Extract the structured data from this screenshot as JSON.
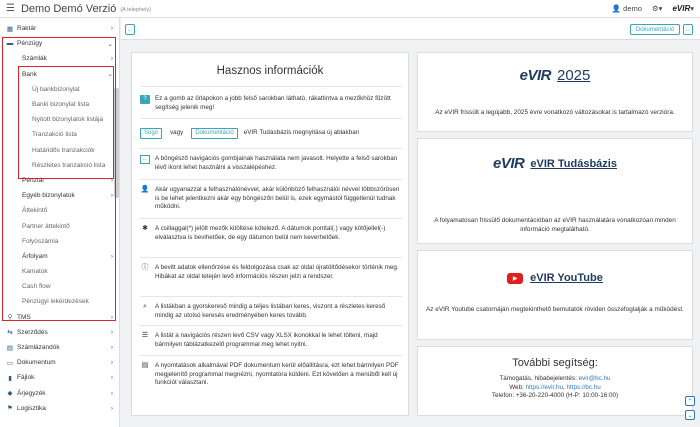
{
  "topbar": {
    "app_title": "Demo Demó Verzió",
    "app_subtitle": "(A telephely)",
    "user": "demo",
    "settings_label": "⚙▾",
    "logo": "eVIR",
    "logo_caret": "▾"
  },
  "sidebar": {
    "raktar": "Raktár",
    "penzugy": "Pénzügy",
    "szamlak": "Számlák",
    "bank": "Bank",
    "bank_items": [
      "Új bankbizonylat",
      "Banki bizonylat lista",
      "Nyitott bizonylatok listája",
      "Tranzakció lista",
      "Határidős tranzakciók",
      "Részletes tranzakció lista"
    ],
    "penztar": "Pénztár",
    "egyeb": "Egyéb bizonylatok",
    "attekinto": "Áttekintő",
    "partner_attekinto": "Partner áttekintő",
    "folyoszamla": "Folyószámla",
    "arfolyam": "Árfolyam",
    "kamatok": "Kamatok",
    "cashflow": "Cash flow",
    "lekerdezesek": "Pénzügyi lekérdezések",
    "tms": "TMS",
    "szerzodes": "Szerződés",
    "szamlazandok": "Számlázandók",
    "dokumentum": "Dokumentum",
    "fajlok": "Fájlok",
    "arjegyzek": "Árjegyzék",
    "logisztika": "Logisztika"
  },
  "toolbar": {
    "back_left": "←",
    "dokumentacio": "Dokumentáció",
    "back_right": "←"
  },
  "info": {
    "title": "Hasznos információk",
    "row1": "Ez a gomb az űrlapokon a jobb felső sarokban látható, rákattintva a mezőkhöz fűzött segítség jelenik meg!",
    "sugo": "Súgó",
    "vagy": "vagy",
    "dokumentacio": "Dokumentáció",
    "row2_text": "eVIR Tudásbázis megnyitása új ablakban",
    "row3": "A böngésző navigációs gombjainak használata nem javasolt. Helyette a felső sarokban lévő ikont lehet használni a visszalépéshez.",
    "row4": "Akár ugyanazzal a felhasználónévvel, akár különböző felhasználói névvel többszörösen is be lehet jelentkezni akár egy böngészőn belül is, ezek egymástól függetlenül tudnak működni.",
    "row5": "A csillaggal(*) jelölt mezők kitöltése kötelező. A dátumok ponttal(.) vagy kötőjellel(-) elválasztva is bevihetőek, de egy dátumon belül nem keverhetőek.",
    "row6": "A bevitt adatok ellenőrzése és feldolgozása csak az oldal újratöltődésekor történik meg. Hibákat az oldal tetején levő információs részen jelzi a rendszer.",
    "row7": "A listákban a gyorskereső mindig a teljes listában keres, viszont a részletes kereső mindig az utolsó keresés eredményében keres tovább.",
    "row8": "A listát a navigációs részen levő CSV vagy XLSX ikonokkal le lehet tölteni, majd bármilyen táblázatkezelő programmal meg lehet nyitni.",
    "row9": "A nyomtatások alkalmával PDF dokumentum kerül előállításra, ezt lehet bármilyen PDF megjelenítő programmal megnézni, nyomtatóra küldeni. Ezt követően a menüből kell új funkciót választani."
  },
  "card2025": {
    "logo": "eVIR",
    "title": "2025",
    "desc": "Az eVIR frissült a legújabb, 2025 évre vonatkozó változásokat is tartalmazó verzióra."
  },
  "cardkb": {
    "logo": "eVIR",
    "title": "eVIR Tudásbázis",
    "desc": "A folyamatosan frissülő dokumentációban az eVIR használatára vonatkozóan minden információ megtalálható."
  },
  "cardyt": {
    "title": "eVIR YouTube",
    "desc": "Az eVIR Youtube csatornáján megtekinthető bemutatók röviden összefoglalják a működést."
  },
  "help": {
    "title": "További segítség:",
    "support_label": "Támogatás, hibabejelentés:",
    "support_email": "evir@bc.hu",
    "web_label": "Web:",
    "web1": "https://evir.hu",
    "web2": "https://bc.hu",
    "phone": "Telefon: +36-20-220-4000 (H-P: 10:00-16:00)"
  }
}
